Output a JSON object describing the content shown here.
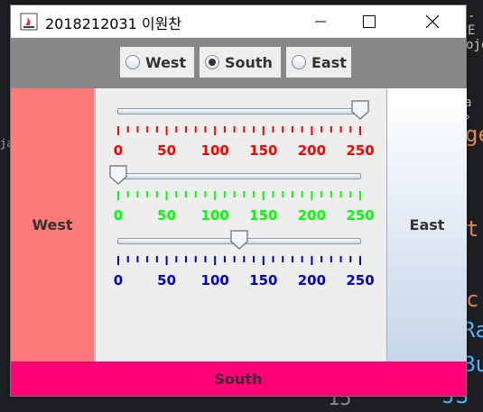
{
  "ide": {
    "fragments": [
      "- E",
      "oje",
      "a ›",
      "ge",
      "t",
      "c",
      "Ra",
      "Bu",
      "JS",
      "ja",
      "15"
    ],
    "line_number": "15"
  },
  "window": {
    "title": "2018212031 이원찬",
    "minimize_glyph": "—",
    "maximize_glyph": "☐",
    "close_glyph": "✕"
  },
  "radios": [
    {
      "label": "West",
      "selected": false
    },
    {
      "label": "South",
      "selected": true
    },
    {
      "label": "East",
      "selected": false
    }
  ],
  "panels": {
    "west": "West",
    "east": "East",
    "south": "South"
  },
  "sliders": [
    {
      "color": "#ff0000",
      "min": 0,
      "max": 250,
      "value": 250,
      "labels": [
        "0",
        "50",
        "100",
        "150",
        "200",
        "250"
      ]
    },
    {
      "color": "#00ff00",
      "min": 0,
      "max": 250,
      "value": 0,
      "labels": [
        "0",
        "50",
        "100",
        "150",
        "200",
        "250"
      ]
    },
    {
      "color": "#0000cc",
      "min": 0,
      "max": 250,
      "value": 125,
      "labels": [
        "0",
        "50",
        "100",
        "150",
        "200",
        "250"
      ]
    }
  ],
  "colors": {
    "west_bg": "#ff7b7b",
    "south_bg": "#ff0077",
    "north_bg": "#888888"
  }
}
